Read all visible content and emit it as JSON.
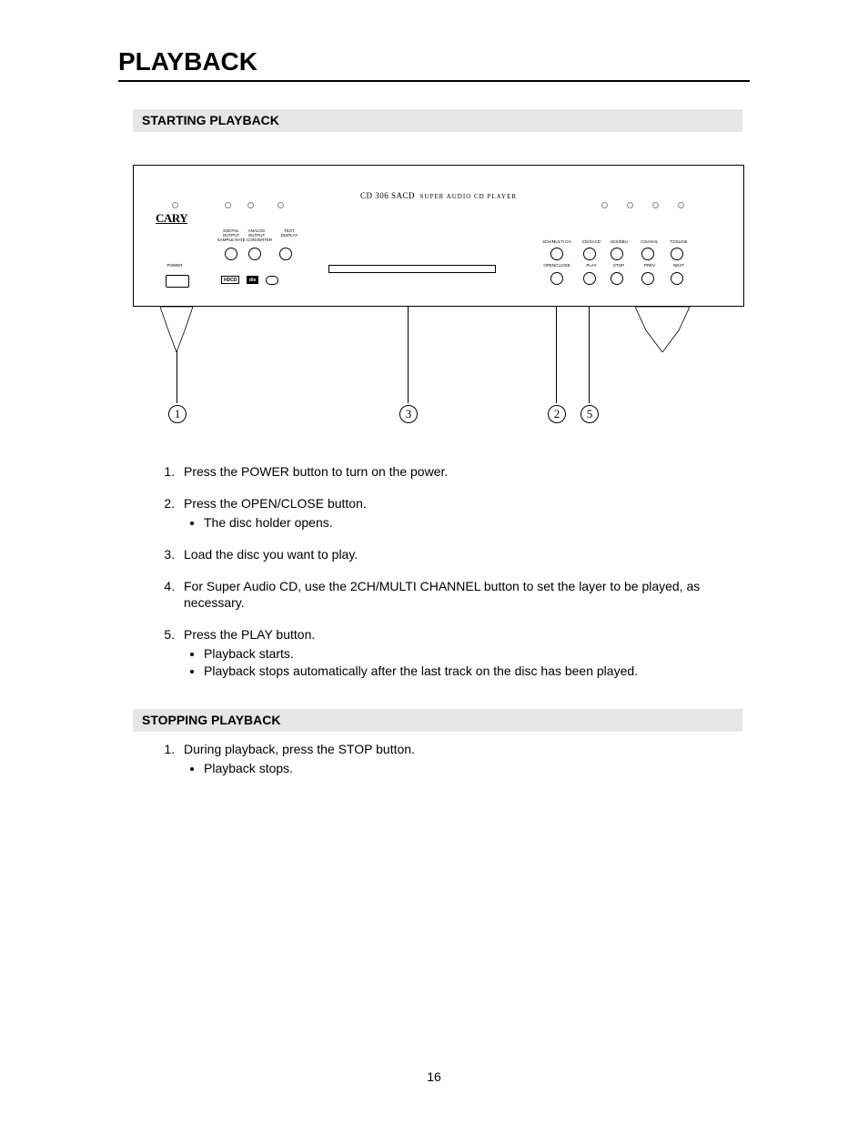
{
  "page_title": "PLAYBACK",
  "page_number": "16",
  "section_a": {
    "heading": "STARTING PLAYBACK",
    "steps": [
      {
        "text": "Press the POWER button to turn on the power.",
        "bullets": []
      },
      {
        "text": "Press the OPEN/CLOSE button.",
        "bullets": [
          "The disc holder opens."
        ]
      },
      {
        "text": "Load the disc you want to play.",
        "bullets": []
      },
      {
        "text": "For Super Audio CD, use the 2CH/MULTI CHANNEL button to set the layer to be played, as necessary.",
        "bullets": []
      },
      {
        "text": "Press the PLAY button.",
        "bullets": [
          "Playback starts.",
          "Playback stops automatically after the last track on the disc has been played."
        ]
      }
    ]
  },
  "section_b": {
    "heading": "STOPPING PLAYBACK",
    "steps": [
      {
        "text": "During playback, press the STOP button.",
        "bullets": [
          "Playback stops."
        ]
      }
    ]
  },
  "diagram": {
    "model": "CD 306 SACD",
    "model_sub": "SUPER AUDIO CD PLAYER",
    "brand": "CARY",
    "left_labels": {
      "digital": "DIGITAL\nOUTPUT",
      "analog": "ANALOG\nOUTPUT",
      "text": "TEXT\nDISPLAY",
      "sample": "SAMPLE RATE CONVERTER",
      "power": "POWER"
    },
    "right_labels_top": [
      "2CH/MULTI CH",
      "CD/SACD",
      "AES/EBU",
      "COAXIAL",
      "TOSLINK"
    ],
    "right_labels_bot": [
      "OPEN/CLOSE",
      "PLAY",
      "STOP",
      "PREV",
      "NEXT"
    ],
    "logos": [
      "HDCD",
      "dts"
    ],
    "callout_numbers": [
      "1",
      "3",
      "2",
      "5"
    ]
  }
}
